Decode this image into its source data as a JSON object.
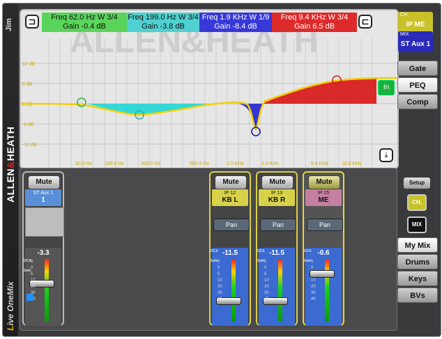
{
  "user": {
    "name": "Jim"
  },
  "brand": {
    "left": "ALLEN",
    "amp": "&",
    "right": "HEATH",
    "watermark": "ALLEN&HEATH"
  },
  "app": {
    "prefix": "L",
    "name": "ive OneMix"
  },
  "eq": {
    "bands": [
      {
        "freq": "Freq 62.0 Hz W 3/4",
        "gain": "Gain -0.4 dB",
        "color": "#5ad45a"
      },
      {
        "freq": "Freq 199.0 Hz W 3/4",
        "gain": "Gain -3.8 dB",
        "color": "#50d0d0"
      },
      {
        "freq": "Freq 1.9 KHz W 1/9",
        "gain": "Gain -8.4 dB",
        "color": "#3838d8"
      },
      {
        "freq": "Freq 9.4 KHz W 3/4",
        "gain": "Gain 6.5 dB",
        "color": "#dd2b2b"
      }
    ],
    "y_ticks": [
      "12 dB",
      "6 dB",
      "0 dB",
      "-6 dB",
      "-12 dB"
    ],
    "x_ticks": [
      "50.0 Hz",
      "100.0 Hz",
      "200.0 Hz",
      "500.0 Hz",
      "1.0 KHz",
      "2.0 KHz",
      "5.0 KHz",
      "10.0 KHz"
    ],
    "in_label": "In",
    "low_shelf_icon": "low-shelf-icon",
    "high_shelf_icon": "high-shelf-icon"
  },
  "channel": {
    "label": "CH.",
    "value": "IP ME",
    "color": "#c9c12a"
  },
  "mix": {
    "label": "MIX",
    "value": "ST Aux 1",
    "color": "#2a2ab8"
  },
  "processing_tabs": [
    {
      "label": "Gate"
    },
    {
      "label": "PEQ",
      "active": true
    },
    {
      "label": "Comp"
    }
  ],
  "mix_tabs": [
    {
      "label": "My Mix",
      "active": true
    },
    {
      "label": "Drums"
    },
    {
      "label": "Keys"
    },
    {
      "label": "BVs"
    }
  ],
  "setup": {
    "label": "Setup",
    "ch": "CH.",
    "mix": "MIX"
  },
  "strips": [
    {
      "mute": "Mute",
      "num": "ST Aux 1",
      "name": "1",
      "value": "-3.3",
      "level": 0.62
    },
    {
      "mute": "Mute",
      "num": "IP 12",
      "name": "KB L",
      "pan": "Pan",
      "value": "-11.5",
      "level": 0.35
    },
    {
      "mute": "Mute",
      "num": "IP 13",
      "name": "KB R",
      "pan": "Pan",
      "value": "-11.5",
      "level": 0.35
    },
    {
      "mute": "Mute",
      "num": "IP 15",
      "name": "ME",
      "pan": "Pan",
      "value": "-0.6",
      "level": 0.78
    }
  ],
  "fader_scale": [
    "5",
    "0",
    "5",
    "10",
    "20",
    "30",
    "40"
  ],
  "fader_labels": {
    "dca": "DCA",
    "safe": "Safe"
  }
}
